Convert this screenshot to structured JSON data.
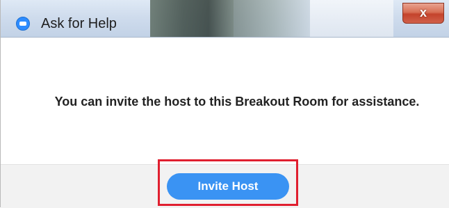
{
  "window": {
    "title": "Ask for Help",
    "app_icon": "zoom-logo-icon",
    "close_label": "x"
  },
  "content": {
    "message": "You can invite the host to this Breakout Room for assistance."
  },
  "footer": {
    "invite_button_label": "Invite Host"
  },
  "colors": {
    "button": "#3a93f3",
    "highlight_outline": "#e01f2f",
    "close_button": "#c4432c"
  }
}
